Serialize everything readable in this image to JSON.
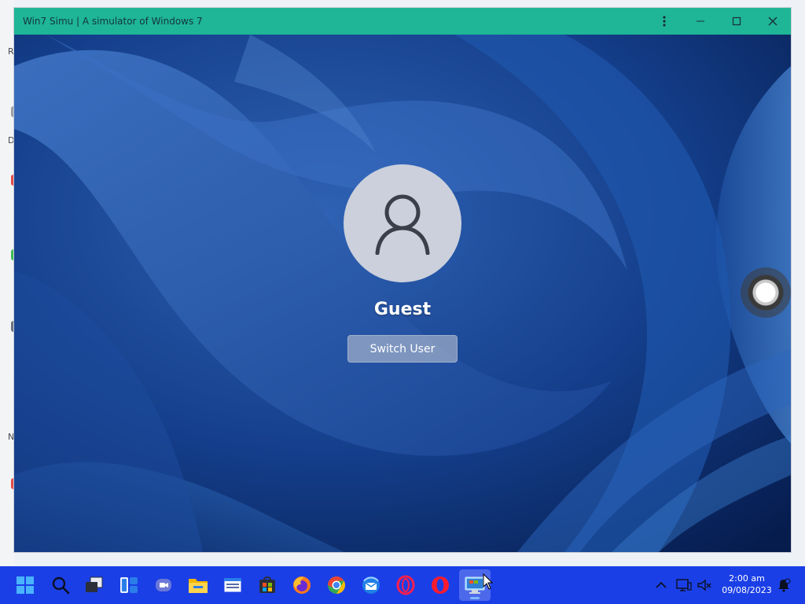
{
  "window": {
    "title": "Win7 Simu | A simulator of Windows 7",
    "titlebar_color": "#1fb597",
    "controls": [
      "more-icon",
      "minimize-icon",
      "maximize-icon",
      "close-icon"
    ]
  },
  "login": {
    "user_name": "Guest",
    "switch_user_label": "Switch User",
    "avatar_icon": "user-icon"
  },
  "desktop_peek": {
    "letters": [
      "R",
      "D",
      "N"
    ]
  },
  "taskbar": {
    "color": "#1b3fe6",
    "apps": [
      {
        "name": "start-icon"
      },
      {
        "name": "search-icon"
      },
      {
        "name": "task-view-icon"
      },
      {
        "name": "widgets-icon"
      },
      {
        "name": "chat-icon"
      },
      {
        "name": "file-explorer-icon"
      },
      {
        "name": "notepad-icon"
      },
      {
        "name": "store-icon"
      },
      {
        "name": "firefox-icon"
      },
      {
        "name": "chrome-icon"
      },
      {
        "name": "thunderbird-icon"
      },
      {
        "name": "opera-gx-icon"
      },
      {
        "name": "opera-icon"
      },
      {
        "name": "win7-simu-icon",
        "active": true
      }
    ],
    "tray": [
      "chevron-up-icon",
      "network-icon",
      "volume-muted-icon"
    ],
    "time": "2:00 am",
    "date": "09/08/2023",
    "notification_icon": "notification-icon"
  }
}
